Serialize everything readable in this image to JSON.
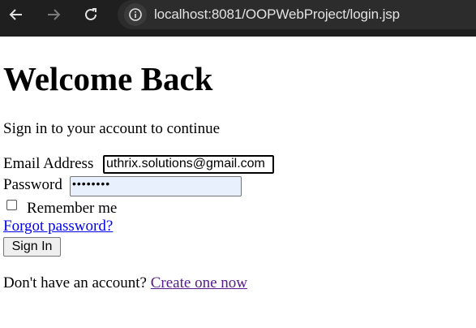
{
  "browser": {
    "url": "localhost:8081/OOPWebProject/login.jsp",
    "back_icon": "arrow-left-icon",
    "forward_icon": "arrow-right-icon",
    "reload_icon": "reload-icon",
    "site_info_icon": "info-icon"
  },
  "login": {
    "title": "Welcome Back",
    "subtitle": "Sign in to your account to continue",
    "email_label": "Email Address",
    "email_value": "uthrix.solutions@gmail.com",
    "password_label": "Password",
    "password_value": "••••••••",
    "remember_label": "Remember me",
    "forgot_link": "Forgot password?",
    "submit_label": "Sign In",
    "signup_prompt": "Don't have an account?",
    "signup_link": "Create one now"
  }
}
